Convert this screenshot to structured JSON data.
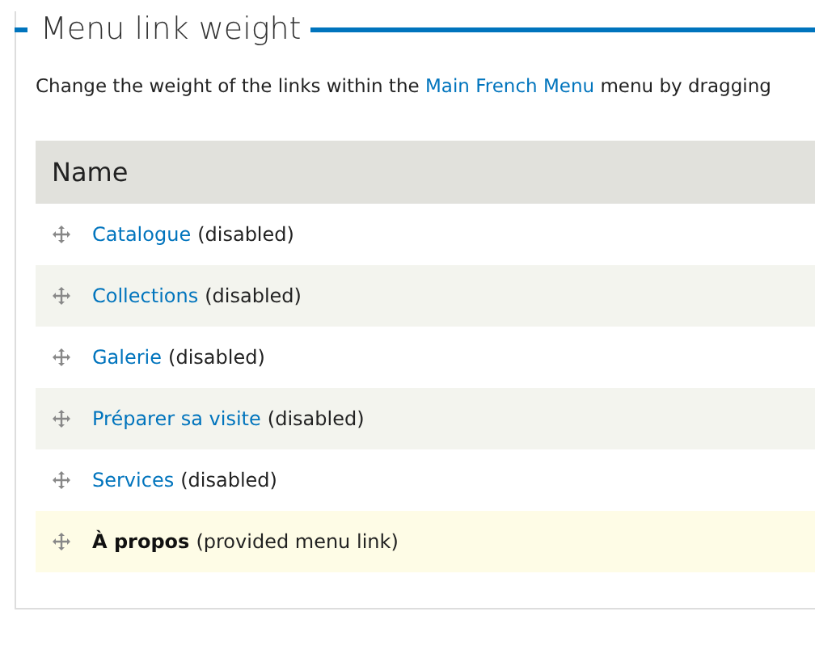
{
  "fieldset": {
    "legend": "Menu link weight",
    "description": {
      "before": "Change the weight of the links within the ",
      "link": "Main French Menu",
      "after": " menu by dragging"
    }
  },
  "table": {
    "columns": [
      "Name"
    ],
    "rows": [
      {
        "title": "Catalogue",
        "note": "(disabled)",
        "kind": "disabled"
      },
      {
        "title": "Collections",
        "note": "(disabled)",
        "kind": "disabled"
      },
      {
        "title": "Galerie",
        "note": "(disabled)",
        "kind": "disabled"
      },
      {
        "title": "Préparer sa visite",
        "note": "(disabled)",
        "kind": "disabled"
      },
      {
        "title": "Services",
        "note": "(disabled)",
        "kind": "disabled"
      },
      {
        "title": "À propos",
        "note": "(provided menu link)",
        "kind": "provided"
      }
    ]
  }
}
